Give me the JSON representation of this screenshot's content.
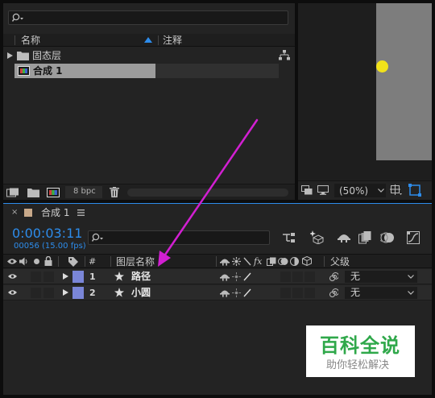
{
  "project_panel": {
    "search": {
      "placeholder": ""
    },
    "columns": {
      "name": "名称",
      "comment": "注释"
    },
    "items": [
      {
        "label": "固态层",
        "type": "folder"
      },
      {
        "label": "合成 1",
        "type": "composition",
        "selected": true
      }
    ],
    "bpc": "8 bpc"
  },
  "viewer": {
    "zoom": "(50%)"
  },
  "timeline": {
    "tab_label": "合成 1",
    "timecode": "0:00:03:11",
    "frame_info": "00056 (15.00 fps)",
    "columns": {
      "num": "#",
      "layer_name": "图层名称",
      "parent": "父级"
    },
    "layers": [
      {
        "num": "1",
        "name": "路径",
        "parent": "无",
        "label_color": "#7a86d8"
      },
      {
        "num": "2",
        "name": "小圆",
        "parent": "无",
        "label_color": "#7a86d8"
      }
    ]
  },
  "watermark": {
    "title": "百科全说",
    "subtitle": "助你轻松解决"
  },
  "colors": {
    "accent_blue": "#2d8ceb",
    "arrow": "#d21fd2",
    "dot": "#f2e21a",
    "watermark_green": "#2fa84a"
  }
}
